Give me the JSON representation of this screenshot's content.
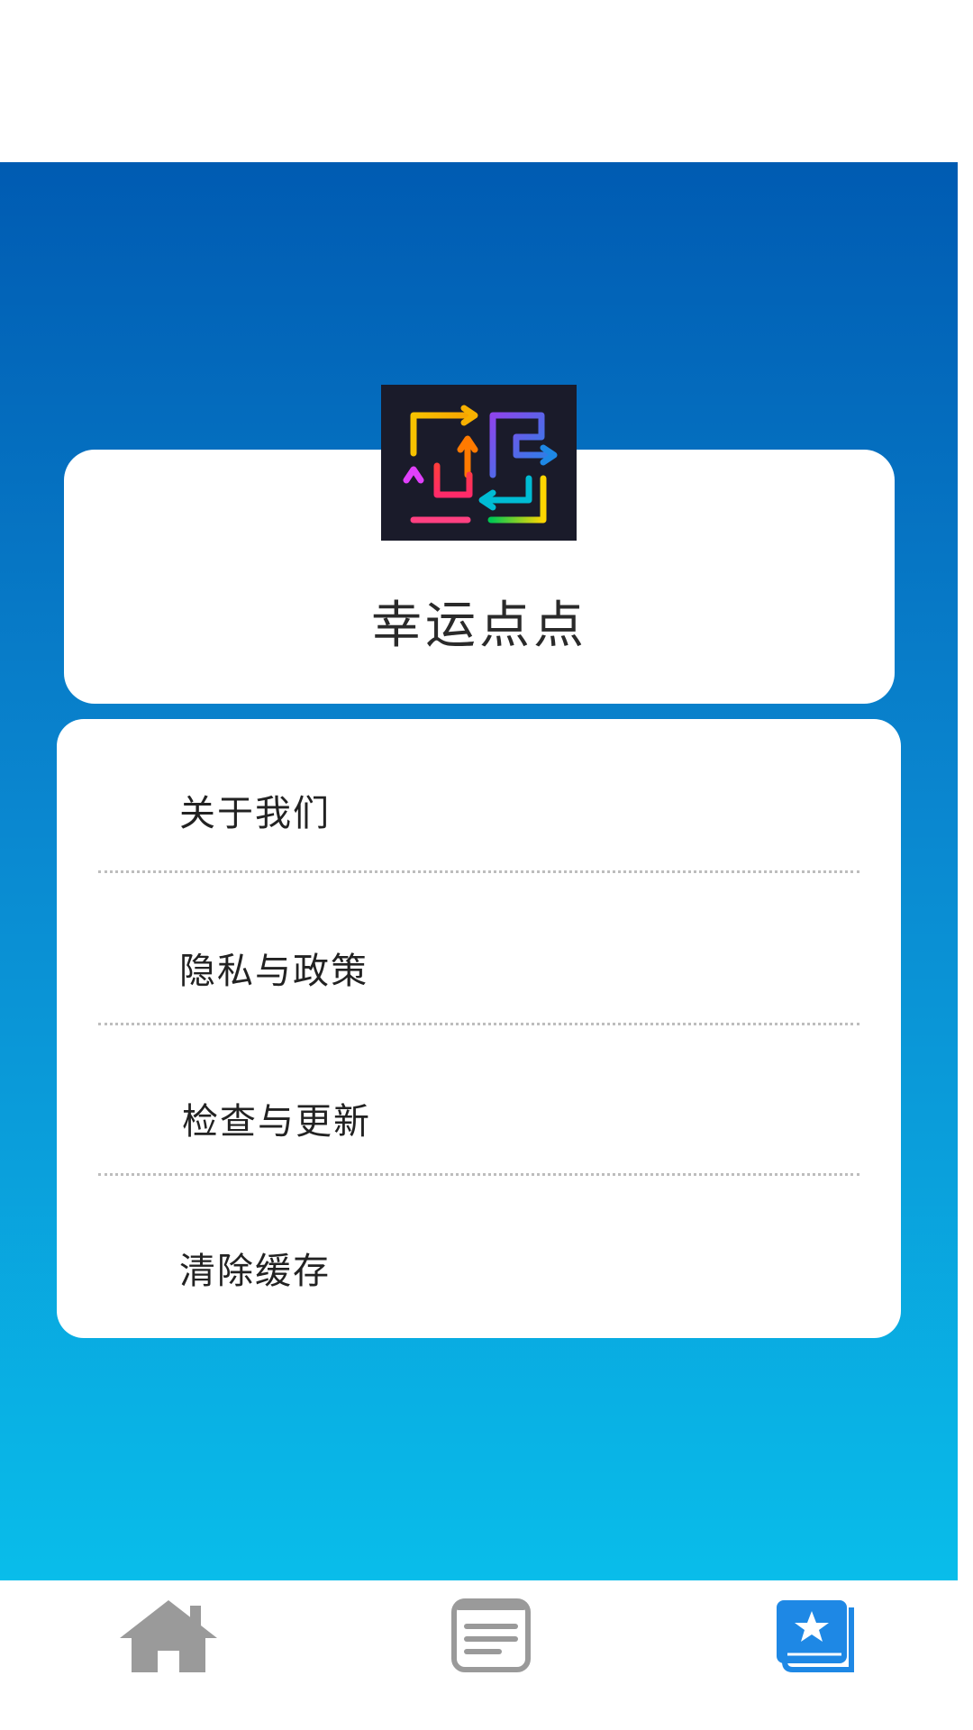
{
  "app": {
    "name": "幸运点点",
    "logo_icon": "colorful-arrow-maze-logo"
  },
  "menu": {
    "items": [
      {
        "label": "关于我们"
      },
      {
        "label": "隐私与政策"
      },
      {
        "label": "检查与更新"
      },
      {
        "label": "清除缓存"
      }
    ]
  },
  "bottom_nav": {
    "items": [
      {
        "icon": "home-icon",
        "color": "#9a9a9a"
      },
      {
        "icon": "document-list-icon",
        "color": "#9a9a9a"
      },
      {
        "icon": "favorites-book-icon",
        "color": "#1e88e5",
        "active": true
      }
    ]
  },
  "colors": {
    "gradient_top": "#005bb2",
    "gradient_bottom": "#09bdea",
    "active_icon": "#1e88e5",
    "inactive_icon": "#9a9a9a"
  }
}
